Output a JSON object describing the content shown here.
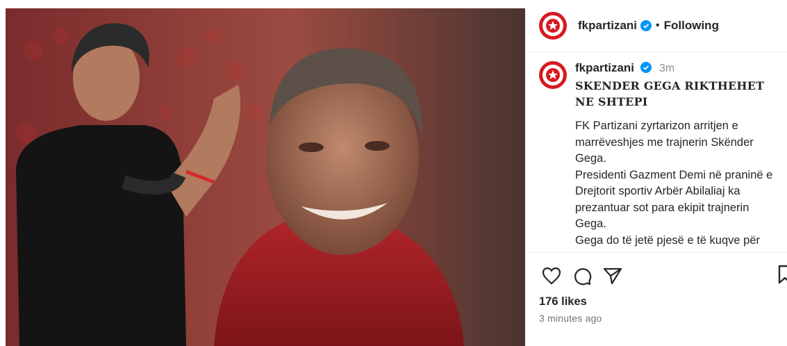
{
  "post": {
    "account": "fkpartizani",
    "follow_state": "Following",
    "separator": "•",
    "time_ago": "3m",
    "title": "SKENDER GEGA RIKTHEHET NE SHTEPI",
    "caption": "FK Partizani zyrtarizon arritjen e marrëveshjes me trajnerin Skënder Gega.\nPresidenti Gazment Demi në praninë e Drejtorit sportiv Arbër Abilaliaj ka prezantuar sot para ekipit trajnerin Gega.\nGega do të jetë pjesë e të kuqve për",
    "likes": "176 likes",
    "timestamp": "3 minutes ago"
  },
  "colors": {
    "brand_red": "#d71920",
    "verified_blue": "#0095f6",
    "muted_text": "#8e8e8e"
  },
  "icons": [
    "like-icon",
    "comment-icon",
    "share-icon",
    "save-icon",
    "verified-badge-icon",
    "club-crest-icon"
  ]
}
